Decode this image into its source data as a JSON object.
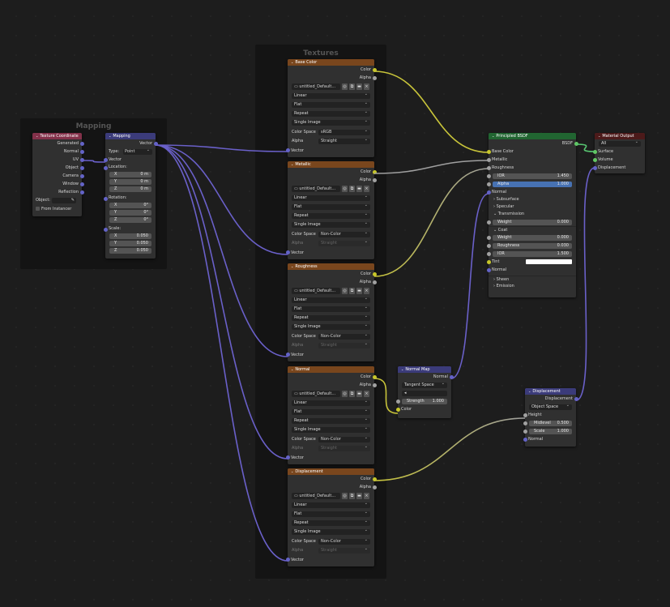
{
  "frames": {
    "mapping": {
      "title": "Mapping"
    },
    "textures": {
      "title": "Textures"
    }
  },
  "colors": {
    "header_input": "#83314a",
    "header_vector": "#3b3b7a",
    "header_texture": "#79461d",
    "header_shader": "#216531",
    "header_output": "#4c1a1a",
    "socket_color": "#c7c729",
    "socket_gray": "#a1a1a1",
    "socket_vector": "#6363c7",
    "socket_shader": "#63c763",
    "wire_vector": "#6a60c9",
    "wire_color": "#c8c43a",
    "wire_gray": "#9f9f9f",
    "wire_shader": "#57c470"
  },
  "texture_coordinate": {
    "title": "Texture Coordinate",
    "outputs": [
      "Generated",
      "Normal",
      "UV",
      "Object",
      "Camera",
      "Window",
      "Reflection"
    ],
    "object_label": "Object:",
    "from_instancer": "From Instancer"
  },
  "mapping": {
    "title": "Mapping",
    "output": "Vector",
    "type_label": "Type:",
    "type_value": "Point",
    "vector_in": "Vector",
    "location": {
      "label": "Location:",
      "x": "0 m",
      "y": "0 m",
      "z": "0 m"
    },
    "rotation": {
      "label": "Rotation:",
      "x": "0°",
      "y": "0°",
      "z": "0°"
    },
    "scale": {
      "label": "Scale:",
      "x": "0.050",
      "y": "0.050",
      "z": "0.050"
    },
    "axis": {
      "x": "X",
      "y": "Y",
      "z": "Z"
    }
  },
  "image_textures": [
    {
      "title": "Base Color",
      "image": "untitled_Default...",
      "interp": "Linear",
      "proj": "Flat",
      "ext": "Repeat",
      "source": "Single Image",
      "cs_label": "Color Space",
      "color_space": "sRGB",
      "alpha_label": "Alpha",
      "alpha": "Straight",
      "alpha_dim": false,
      "out_color": "Color",
      "out_alpha": "Alpha",
      "in_vector": "Vector"
    },
    {
      "title": "Metallic",
      "image": "untitled_Default...",
      "interp": "Linear",
      "proj": "Flat",
      "ext": "Repeat",
      "source": "Single Image",
      "cs_label": "Color Space",
      "color_space": "Non-Color",
      "alpha_label": "Alpha",
      "alpha": "Straight",
      "alpha_dim": true,
      "out_color": "Color",
      "out_alpha": "Alpha",
      "in_vector": "Vector"
    },
    {
      "title": "Roughness",
      "image": "untitled_Default...",
      "interp": "Linear",
      "proj": "Flat",
      "ext": "Repeat",
      "source": "Single Image",
      "cs_label": "Color Space",
      "color_space": "Non-Color",
      "alpha_label": "Alpha",
      "alpha": "Straight",
      "alpha_dim": true,
      "out_color": "Color",
      "out_alpha": "Alpha",
      "in_vector": "Vector"
    },
    {
      "title": "Normal",
      "image": "untitled_Default...",
      "interp": "Linear",
      "proj": "Flat",
      "ext": "Repeat",
      "source": "Single Image",
      "cs_label": "Color Space",
      "color_space": "Non-Color",
      "alpha_label": "Alpha",
      "alpha": "Straight",
      "alpha_dim": true,
      "out_color": "Color",
      "out_alpha": "Alpha",
      "in_vector": "Vector"
    },
    {
      "title": "Displacement",
      "image": "untitled_Default...",
      "interp": "Linear",
      "proj": "Flat",
      "ext": "Repeat",
      "source": "Single Image",
      "cs_label": "Color Space",
      "color_space": "Non-Color",
      "alpha_label": "Alpha",
      "alpha": "Straight",
      "alpha_dim": true,
      "out_color": "Color",
      "out_alpha": "Alpha",
      "in_vector": "Vector"
    }
  ],
  "normal_map": {
    "title": "Normal Map",
    "output": "Normal",
    "space": "Tangent Space",
    "uv_field": "",
    "strength_label": "Strength",
    "strength": "1.000",
    "input": "Color"
  },
  "principled": {
    "title": "Principled BSDF",
    "output": "BSDF",
    "base_color": "Base Color",
    "metallic": "Metallic",
    "roughness": "Roughness",
    "ior_label": "IOR",
    "ior": "1.450",
    "alpha_label": "Alpha",
    "alpha": "1.000",
    "normal": "Normal",
    "subsurface": "Subsurface",
    "specular": "Specular",
    "transmission": "Transmission",
    "weight_label": "Weight",
    "transmission_weight": "0.000",
    "coat": "Coat",
    "coat_weight": "0.000",
    "coat_roughness_label": "Roughness",
    "coat_roughness": "0.030",
    "coat_ior_label": "IOR",
    "coat_ior": "1.500",
    "tint_label": "Tint",
    "coat_normal": "Normal",
    "sheen": "Sheen",
    "emission": "Emission"
  },
  "material_output": {
    "title": "Material Output",
    "target": "All",
    "surface": "Surface",
    "volume": "Volume",
    "displacement": "Displacement"
  },
  "displacement": {
    "title": "Displacement",
    "output": "Displacement",
    "space": "Object Space",
    "height": "Height",
    "midlevel_label": "Midlevel",
    "midlevel": "0.500",
    "scale_label": "Scale",
    "scale": "1.000",
    "normal": "Normal"
  }
}
